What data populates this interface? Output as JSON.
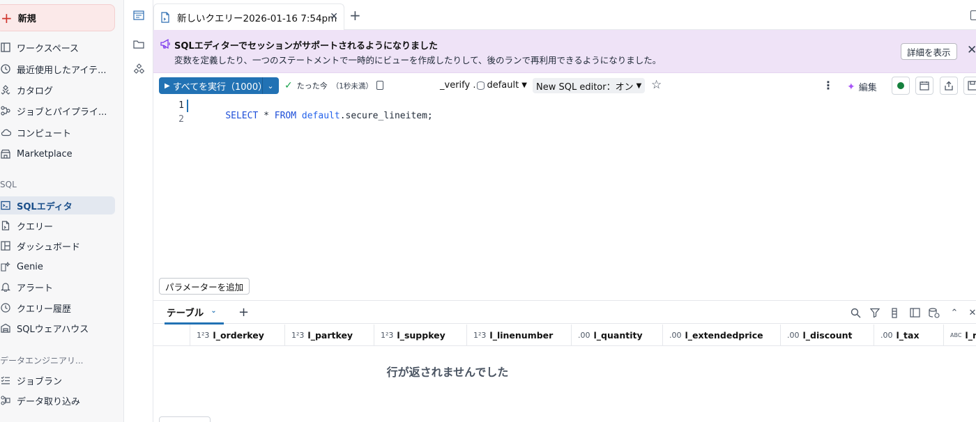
{
  "sidebar": {
    "new_label": "新規",
    "items": [
      {
        "label": "ワークスペース",
        "icon": "workspace-icon"
      },
      {
        "label": "最近使用したアイテ...",
        "icon": "clock-icon"
      },
      {
        "label": "カタログ",
        "icon": "catalog-icon"
      },
      {
        "label": "ジョブとパイプライ...",
        "icon": "workflow-icon"
      },
      {
        "label": "コンピュート",
        "icon": "cloud-icon"
      },
      {
        "label": "Marketplace",
        "icon": "store-icon"
      }
    ],
    "sql_section_label": "SQL",
    "sql_items": [
      {
        "label": "SQLエディタ",
        "icon": "sql-editor-icon",
        "active": true
      },
      {
        "label": "クエリー",
        "icon": "query-icon"
      },
      {
        "label": "ダッシュボード",
        "icon": "dashboard-icon"
      },
      {
        "label": "Genie",
        "icon": "genie-icon"
      },
      {
        "label": "アラート",
        "icon": "bell-icon"
      },
      {
        "label": "クエリー履歴",
        "icon": "history-icon"
      },
      {
        "label": "SQLウェアハウス",
        "icon": "warehouse-icon"
      }
    ],
    "de_section_label": "データエンジニアリ...",
    "de_items": [
      {
        "label": "ジョブラン",
        "icon": "job-runs-icon"
      },
      {
        "label": "データ取り込み",
        "icon": "ingest-icon"
      }
    ]
  },
  "tab": {
    "label": "新しいクエリー2026-01-16 7:54pm",
    "close": "✕",
    "add": "+"
  },
  "banner": {
    "title": "SQLエディターでセッションがサポートされるようになりました",
    "description": "変数を定義したり、一つのステートメントで一時的にビューを作成したりして、後のランで再利用できるようになりました。",
    "details_button": "詳細を表示",
    "close": "✕",
    "accent": "#7c3aed"
  },
  "toolbar": {
    "run_label": "すべてを実行（1000）",
    "run_color": "#2272b4",
    "status": "たった今",
    "status_sub": "（1秒未満）",
    "catalog": "_verify",
    "schema": "default",
    "editor_toggle": "New SQL editor：オン",
    "edit_label": "編集"
  },
  "editor": {
    "lines": [
      {
        "no": "1",
        "tokens": [
          {
            "t": "SELECT",
            "c": "kw"
          },
          {
            "t": " * ",
            "c": ""
          },
          {
            "t": "FROM",
            "c": "kw"
          },
          {
            "t": " ",
            "c": ""
          },
          {
            "t": "default",
            "c": "ident"
          },
          {
            "t": ".secure_lineitem;",
            "c": ""
          }
        ]
      },
      {
        "no": "2",
        "tokens": []
      }
    ]
  },
  "params_button": "パラメーターを追加",
  "results": {
    "tab_label": "テーブル",
    "add": "+",
    "columns": [
      {
        "type": "1²3",
        "name": "l_orderkey"
      },
      {
        "type": "1²3",
        "name": "l_partkey"
      },
      {
        "type": "1²3",
        "name": "l_suppkey"
      },
      {
        "type": "1²3",
        "name": "l_linenumber"
      },
      {
        "type": ".00",
        "name": "l_quantity"
      },
      {
        "type": ".00",
        "name": "l_extendedprice"
      },
      {
        "type": ".00",
        "name": "l_discount"
      },
      {
        "type": ".00",
        "name": "l_tax"
      },
      {
        "type": "ABC",
        "name": "l_re"
      }
    ],
    "empty_message": "行が返されませんでした"
  }
}
